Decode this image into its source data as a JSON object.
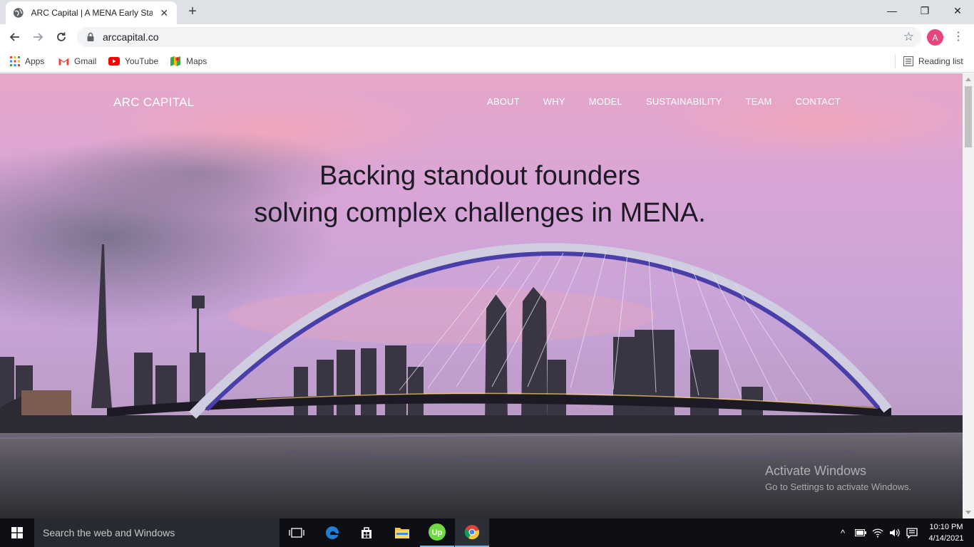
{
  "browser": {
    "tab_title": "ARC Capital | A MENA Early Stage VC",
    "tab_close": "✕",
    "new_tab": "+",
    "url": "arccapital.co",
    "profile_initial": "A",
    "window_minimize": "—",
    "window_restore": "❐",
    "window_close": "✕"
  },
  "bookmarks": {
    "items": [
      {
        "label": "Apps"
      },
      {
        "label": "Gmail"
      },
      {
        "label": "YouTube"
      },
      {
        "label": "Maps"
      }
    ],
    "reading_list": "Reading list"
  },
  "site": {
    "logo": "ARC CAPITAL",
    "nav": [
      "ABOUT",
      "WHY",
      "MODEL",
      "SUSTAINABILITY",
      "TEAM",
      "CONTACT"
    ],
    "headline_line1": "Backing standout founders",
    "headline_line2": "solving complex challenges in MENA."
  },
  "watermark": {
    "line1": "Activate Windows",
    "line2": "Go to Settings to activate Windows."
  },
  "taskbar": {
    "search_placeholder": "Search the web and Windows",
    "time": "10:10 PM",
    "date": "4/14/2021"
  },
  "colors": {
    "sky_top": "#e7a3c3",
    "sky_mid": "#cf9fd6",
    "bridge_arch": "#4a3fa8",
    "profile": "#e8457a"
  }
}
